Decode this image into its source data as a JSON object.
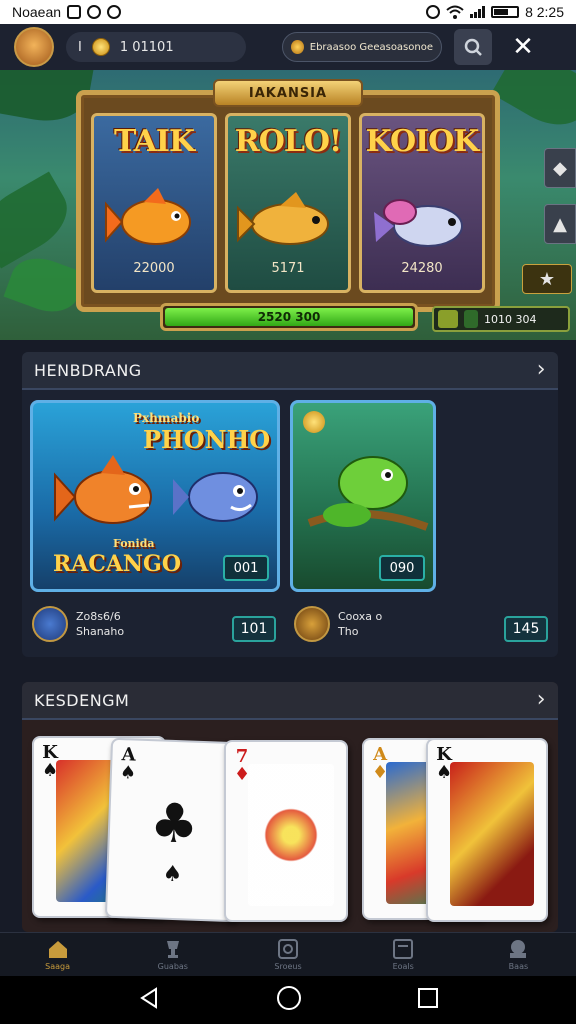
{
  "status_bar": {
    "carrier": "Noaean",
    "time": "8 2:25"
  },
  "top_bar": {
    "balance": "1 01101",
    "balance_prefix": "I",
    "notice_text": "Ebraasoo Geeasoasonoe"
  },
  "hero": {
    "marquee_title": "IAKANSIA",
    "reels": [
      {
        "title": "TAIK",
        "value": "22000"
      },
      {
        "title": "ROLO!",
        "value": "5171"
      },
      {
        "title": "KOIOK",
        "value": "24280"
      }
    ],
    "progress_label": "2520 300",
    "progress_value": 1.0,
    "balance_pill": "1010 304"
  },
  "section1": {
    "title": "HENBDRANG",
    "cards": [
      {
        "title_top": "PHONHO",
        "title_top_small": "Pxhmabio",
        "title_bottom_small": "Fonida",
        "title_bottom": "RACANGO",
        "badge": "001",
        "meta_line1": "Zo8s6/6",
        "meta_line2": "Shanaho",
        "meta_badge": "101"
      },
      {
        "badge": "090",
        "meta_line1": "Cooxa o",
        "meta_line2": "Tho",
        "meta_badge": "145"
      }
    ]
  },
  "section2": {
    "title": "KESDENGM"
  },
  "bottom_nav": {
    "items": [
      {
        "label": "Saaga"
      },
      {
        "label": "Guabas"
      },
      {
        "label": "Sroeus"
      },
      {
        "label": "Eoals"
      },
      {
        "label": "Baas"
      }
    ]
  },
  "colors": {
    "accent_gold": "#c89b3c",
    "progress_green": "#31a816",
    "card_border_blue": "#5fb0e6",
    "badge_teal": "#2ab0a6"
  }
}
